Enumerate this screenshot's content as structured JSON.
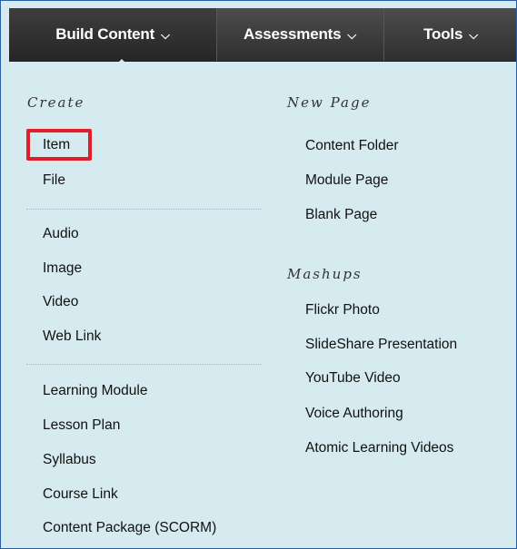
{
  "tabs": {
    "build_content": "Build Content",
    "assessments": "Assessments",
    "tools": "Tools"
  },
  "left_column": {
    "heading": "Create",
    "group1": [
      "Item",
      "File"
    ],
    "group2": [
      "Audio",
      "Image",
      "Video",
      "Web Link"
    ],
    "group3": [
      "Learning Module",
      "Lesson Plan",
      "Syllabus",
      "Course Link",
      "Content Package (SCORM)"
    ]
  },
  "right_column": {
    "new_page_heading": "New Page",
    "new_page_items": [
      "Content Folder",
      "Module Page",
      "Blank Page"
    ],
    "mashups_heading": "Mashups",
    "mashups_items": [
      "Flickr Photo",
      "SlideShare Presentation",
      "YouTube Video",
      "Voice Authoring",
      "Atomic Learning Videos"
    ]
  },
  "highlighted_item": "Item",
  "colors": {
    "menu_background": "#d6ebf0",
    "tab_bar": "#3a3a3a",
    "highlight_border": "#e31e24"
  },
  "icons": {
    "tab_dropdown": "chevron-down-icon"
  }
}
